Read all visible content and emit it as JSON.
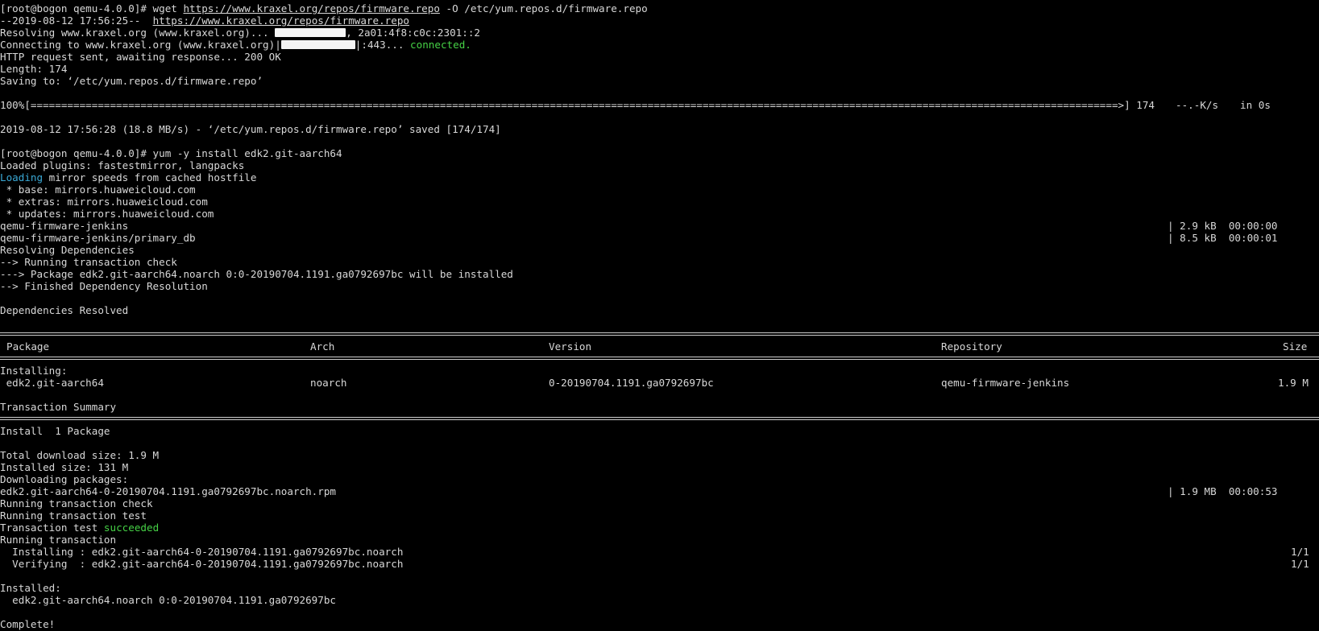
{
  "lines": {
    "l0": "[root@bogon qemu-4.0.0]# wget ",
    "l0_url": "https://www.kraxel.org/repos/firmware.repo",
    "l0_tail": " -O /etc/yum.repos.d/firmware.repo",
    "l1": "--2019-08-12 17:56:25--  ",
    "l1_url": "https://www.kraxel.org/repos/firmware.repo",
    "l2": "Resolving www.kraxel.org (www.kraxel.org)... ",
    "l2_tail": ", 2a01:4f8:c0c:2301::2",
    "l3": "Connecting to www.kraxel.org (www.kraxel.org)|",
    "l3_tail": "|:443... ",
    "l3_connected": "connected.",
    "l4": "HTTP request sent, awaiting response... 200 OK",
    "l5": "Length: 174",
    "l6": "Saving to: ‘/etc/yum.repos.d/firmware.repo’",
    "progress_left": "100%[==================================================================================================================================================================================>] 174",
    "progress_rate": "--.-K/s",
    "progress_time": "in 0s",
    "saved": "2019-08-12 17:56:28 (18.8 MB/s) - ‘/etc/yum.repos.d/firmware.repo’ saved [174/174]",
    "yum_cmd": "[root@bogon qemu-4.0.0]# yum -y install edk2.git-aarch64",
    "plugins": "Loaded plugins: fastestmirror, langpacks",
    "loading": "Loading",
    "loading_tail": " mirror speeds from cached hostfile",
    "base": " * base: mirrors.huaweicloud.com",
    "extras": " * extras: mirrors.huaweicloud.com",
    "updates": " * updates: mirrors.huaweicloud.com",
    "repo1": "qemu-firmware-jenkins",
    "repo1_right": "| 2.9 kB  00:00:00",
    "repo2": "qemu-firmware-jenkins/primary_db",
    "repo2_right": "| 8.5 kB  00:00:01",
    "resolving_deps": "Resolving Dependencies",
    "running_check": "--> Running transaction check",
    "package_line": "---> Package edk2.git-aarch64.noarch 0:0-20190704.1191.ga0792697bc will be installed",
    "finished": "--> Finished Dependency Resolution",
    "deps_resolved": "Dependencies Resolved",
    "installing_hdr": "Installing:",
    "txn_summary": "Transaction Summary",
    "install_count": "Install  1 Package",
    "total_dl": "Total download size: 1.9 M",
    "installed_size": "Installed size: 131 M",
    "downloading": "Downloading packages:",
    "rpm_file": "edk2.git-aarch64-0-20190704.1191.ga0792697bc.noarch.rpm",
    "rpm_right": "| 1.9 MB  00:00:53",
    "run_check": "Running transaction check",
    "run_test": "Running transaction test",
    "test_prefix": "Transaction test ",
    "test_succeeded": "succeeded",
    "running_txn": "Running transaction",
    "installing_line": "  Installing : edk2.git-aarch64-0-20190704.1191.ga0792697bc.noarch",
    "installing_count": "1/1",
    "verifying_line": "  Verifying  : edk2.git-aarch64-0-20190704.1191.ga0792697bc.noarch",
    "verifying_count": "1/1",
    "installed_hdr": "Installed:",
    "installed_pkg": "  edk2.git-aarch64.noarch 0:0-20190704.1191.ga0792697bc",
    "complete": "Complete!"
  },
  "table": {
    "headers": {
      "package": "Package",
      "arch": "Arch",
      "version": "Version",
      "repository": "Repository",
      "size": "Size"
    },
    "row": {
      "package": " edk2.git-aarch64",
      "arch": "noarch",
      "version": "0-20190704.1191.ga0792697bc",
      "repository": "qemu-firmware-jenkins",
      "size": "1.9 M"
    }
  },
  "colors": {
    "background": "#000000",
    "text": "#d8d8d8",
    "green": "#46d246",
    "cyan": "#3aa9d6"
  }
}
